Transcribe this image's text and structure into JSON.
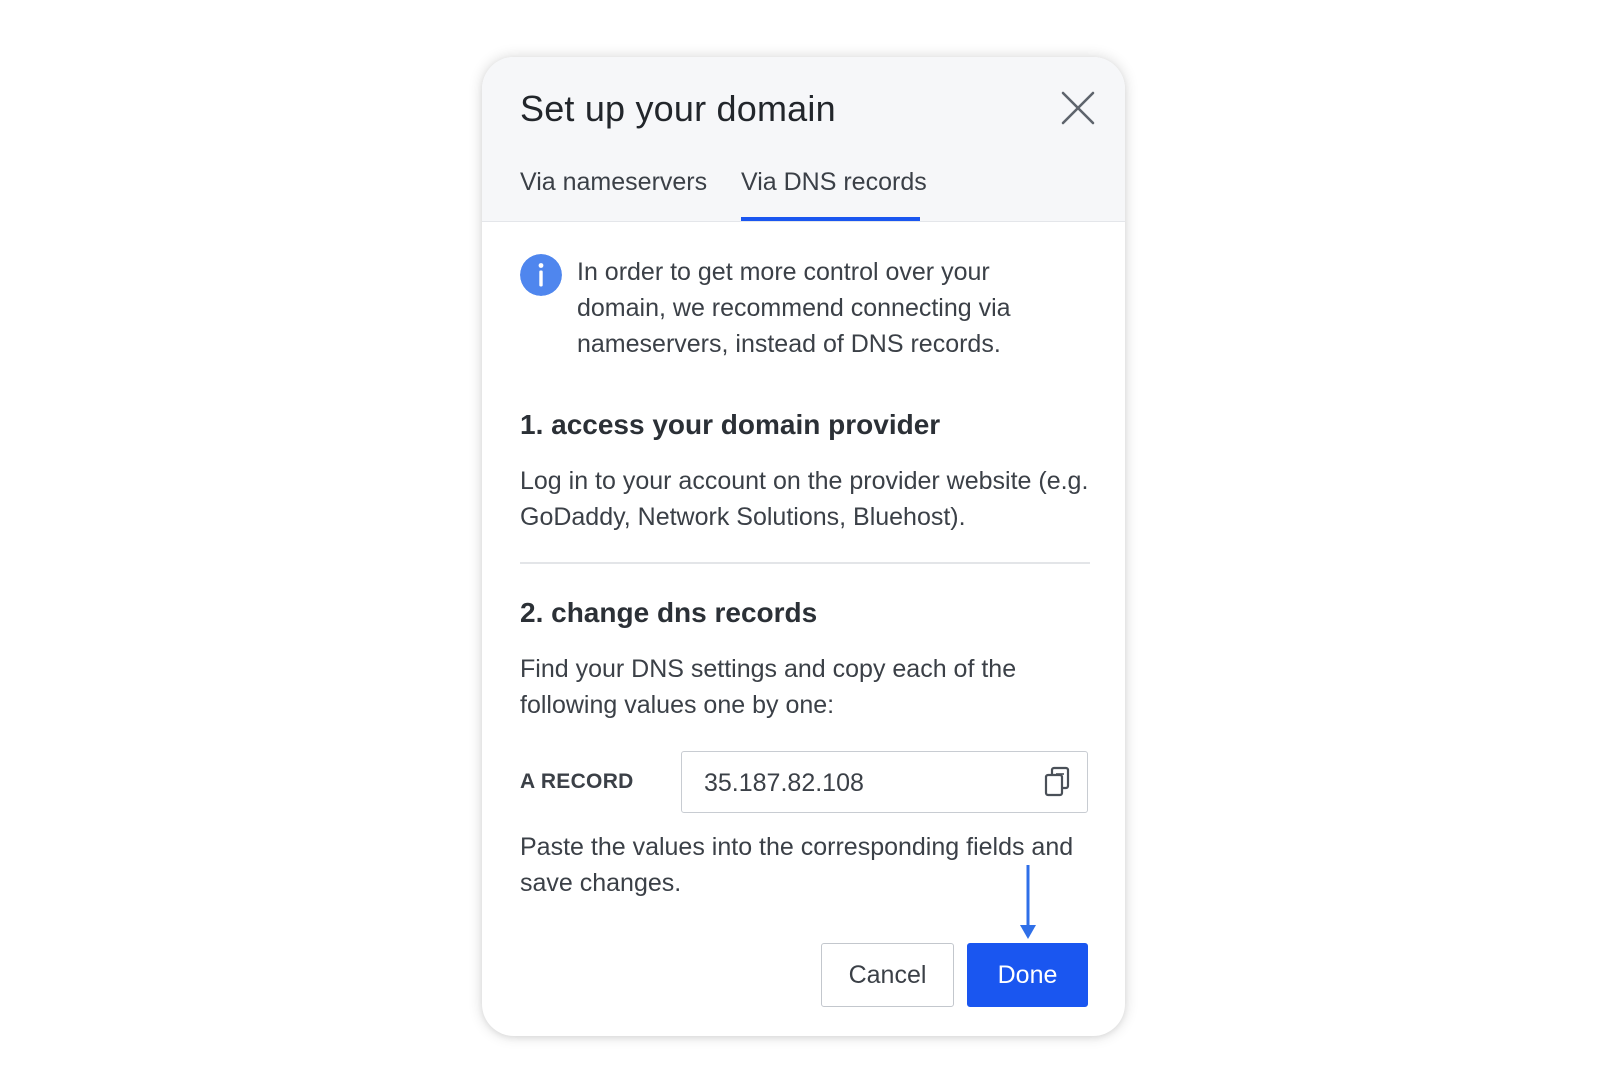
{
  "dialog": {
    "title": "Set up your domain",
    "close_icon": "close-icon"
  },
  "tabs": [
    {
      "label": "Via nameservers",
      "active": false
    },
    {
      "label": "Via DNS records",
      "active": true
    }
  ],
  "info": {
    "icon": "info-icon",
    "text": "In order to get more control over your domain, we recommend connecting via nameservers, instead of DNS records."
  },
  "steps": [
    {
      "title": "1. access your domain provider",
      "body": "Log in to your account on the provider website (e.g. GoDaddy, Network Solutions, Bluehost)."
    },
    {
      "title": "2. change dns records",
      "body": "Find your DNS settings and copy each of the following values one by one:"
    }
  ],
  "record": {
    "label": "A RECORD",
    "value": "35.187.82.108",
    "copy_icon": "copy-icon"
  },
  "paste_text": "Paste the values into the corresponding fields and save changes.",
  "buttons": {
    "cancel": "Cancel",
    "done": "Done"
  },
  "colors": {
    "accent": "#1a56f0",
    "info_icon": "#4f86ee",
    "header_bg": "#f6f7f9",
    "annotation_arrow": "#2f6fe8"
  }
}
